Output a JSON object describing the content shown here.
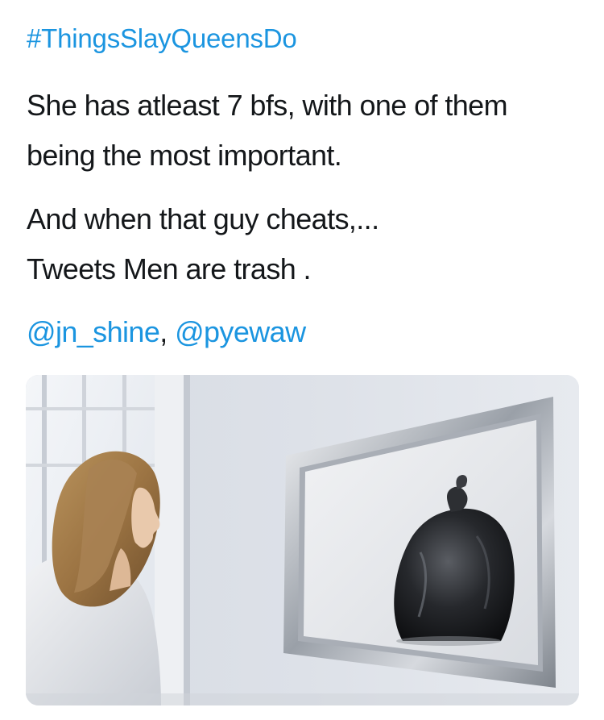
{
  "tweet": {
    "hashtag": "#ThingsSlayQueensDo",
    "lines": [
      "She has atleast 7 bfs, with one of them",
      "being the most important.",
      "And when that guy cheats,...",
      "Tweets Men are trash ."
    ],
    "mentions": [
      "@jn_shine",
      "@pyewaw"
    ],
    "mention_separator": ", "
  },
  "colors": {
    "link": "#1b95e0",
    "text": "#14171a",
    "background": "#ffffff"
  }
}
